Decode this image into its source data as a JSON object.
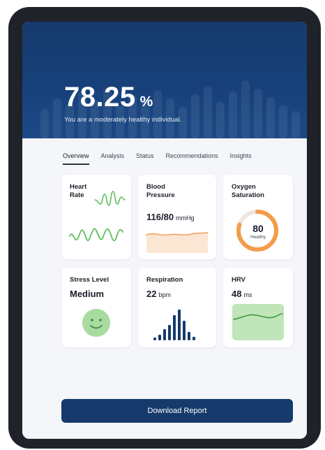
{
  "score": {
    "value": "78.25",
    "unit": "%",
    "description": "You are a moderately healthy individual."
  },
  "tabs": [
    {
      "label": "Overview",
      "active": true
    },
    {
      "label": "Analysis",
      "active": false
    },
    {
      "label": "Status",
      "active": false
    },
    {
      "label": "Recommendations",
      "active": false
    },
    {
      "label": "Insights",
      "active": false
    }
  ],
  "cards": {
    "heart_rate": {
      "title_line1": "Heart",
      "title_line2": "Rate",
      "icon": "heartbeat-wave-icon"
    },
    "blood_pressure": {
      "title_line1": "Blood",
      "title_line2": "Pressure",
      "value": "116/80",
      "unit": "mmHg"
    },
    "oxygen": {
      "title_line1": "Oxygen",
      "title_line2": "Saturation",
      "value": "80",
      "status": "Healthy",
      "level_percent": 80
    },
    "stress": {
      "title": "Stress Level",
      "value": "Medium",
      "icon": "smiley-face-icon"
    },
    "respiration": {
      "title": "Respiration",
      "value": "22",
      "unit": "bpm"
    },
    "hrv": {
      "title": "HRV",
      "value": "48",
      "unit": "ms"
    }
  },
  "actions": {
    "download_label": "Download Report"
  },
  "colors": {
    "primary": "#163a6c",
    "heart_green": "#5cbf5c",
    "bp_orange": "#f0a45c",
    "oxygen_orange": "#f39c4a",
    "stress_green": "#a8dba0",
    "hrv_green": "#bfe5b8"
  }
}
